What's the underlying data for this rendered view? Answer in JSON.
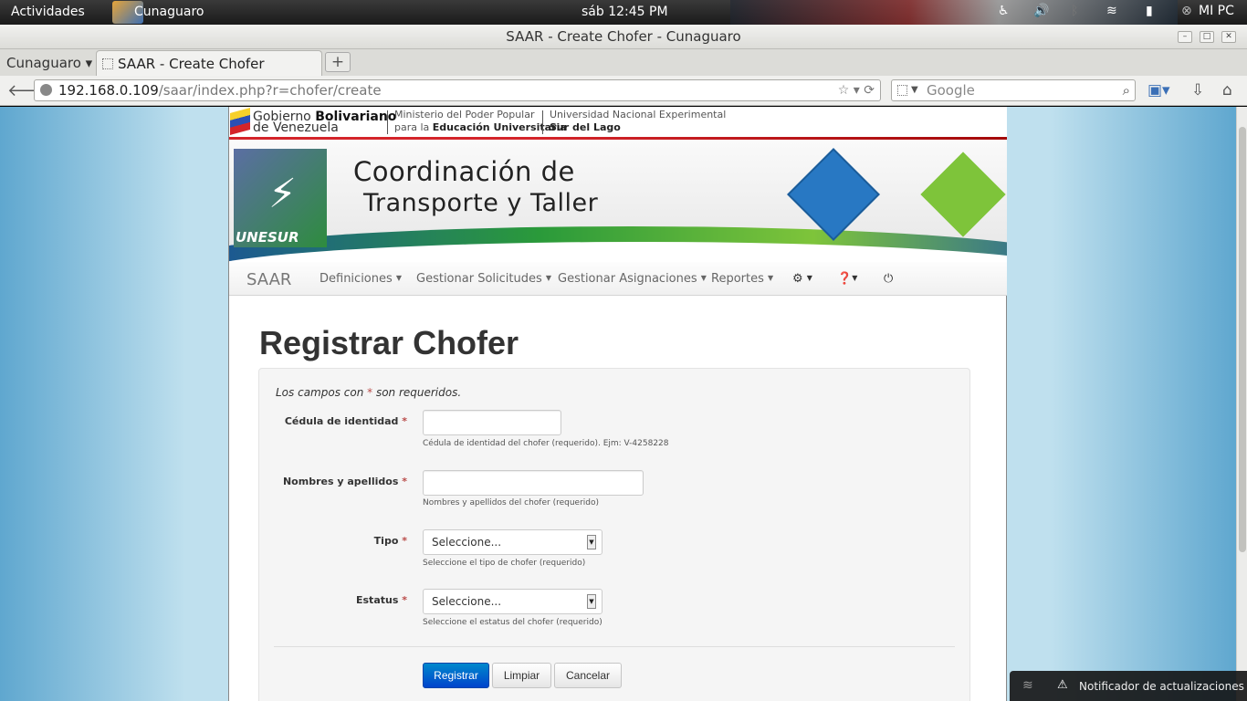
{
  "topbar": {
    "activities": "Actividades",
    "app_name": "Cunaguaro",
    "clock": "sáb 12:45 PM",
    "user": "MI PC"
  },
  "window": {
    "title": "SAAR - Create Chofer - Cunaguaro"
  },
  "tabs": {
    "group_menu": "Cunaguaro ▾",
    "active_tab": "SAAR - Create Chofer",
    "new_tab": "+"
  },
  "address": {
    "host": "192.168.0.109",
    "path": "/saar/index.php?r=chofer/create",
    "search_placeholder": "Google"
  },
  "gov_header": {
    "gob_line1_a": "Gobierno ",
    "gob_line1_b": "Bolivariano",
    "gob_line2": "de Venezuela",
    "ministerio_l1": "Ministerio del Poder Popular",
    "ministerio_l2_a": "para la ",
    "ministerio_l2_b": "Educación Universitaria",
    "univ_l1": "Universidad Nacional Experimental",
    "univ_l2": "Sur del Lago"
  },
  "banner": {
    "title_line1": "Coordinación de",
    "title_line2": "Transporte y Taller",
    "logo_text": "UNESUR"
  },
  "nav": {
    "brand": "SAAR",
    "items": [
      "Definiciones",
      "Gestionar Solicitudes",
      "Gestionar Asignaciones",
      "Reportes"
    ]
  },
  "form": {
    "heading": "Registrar Chofer",
    "required_note_pre": "Los campos con ",
    "required_mark": "*",
    "required_note_post": " son requeridos.",
    "fields": [
      {
        "label": "Cédula de identidad",
        "help": "Cédula de identidad del chofer (requerido). Ejm: V-4258228"
      },
      {
        "label": "Nombres y apellidos",
        "help": "Nombres y apellidos del chofer (requerido)"
      },
      {
        "label": "Tipo",
        "value": "Seleccione...",
        "help": "Seleccione el tipo de chofer (requerido)"
      },
      {
        "label": "Estatus",
        "value": "Seleccione...",
        "help": "Seleccione el estatus del chofer (requerido)"
      }
    ],
    "buttons": {
      "submit": "Registrar",
      "reset": "Limpiar",
      "cancel": "Cancelar"
    }
  },
  "notification": {
    "text": "Notificador de actualizaciones"
  }
}
